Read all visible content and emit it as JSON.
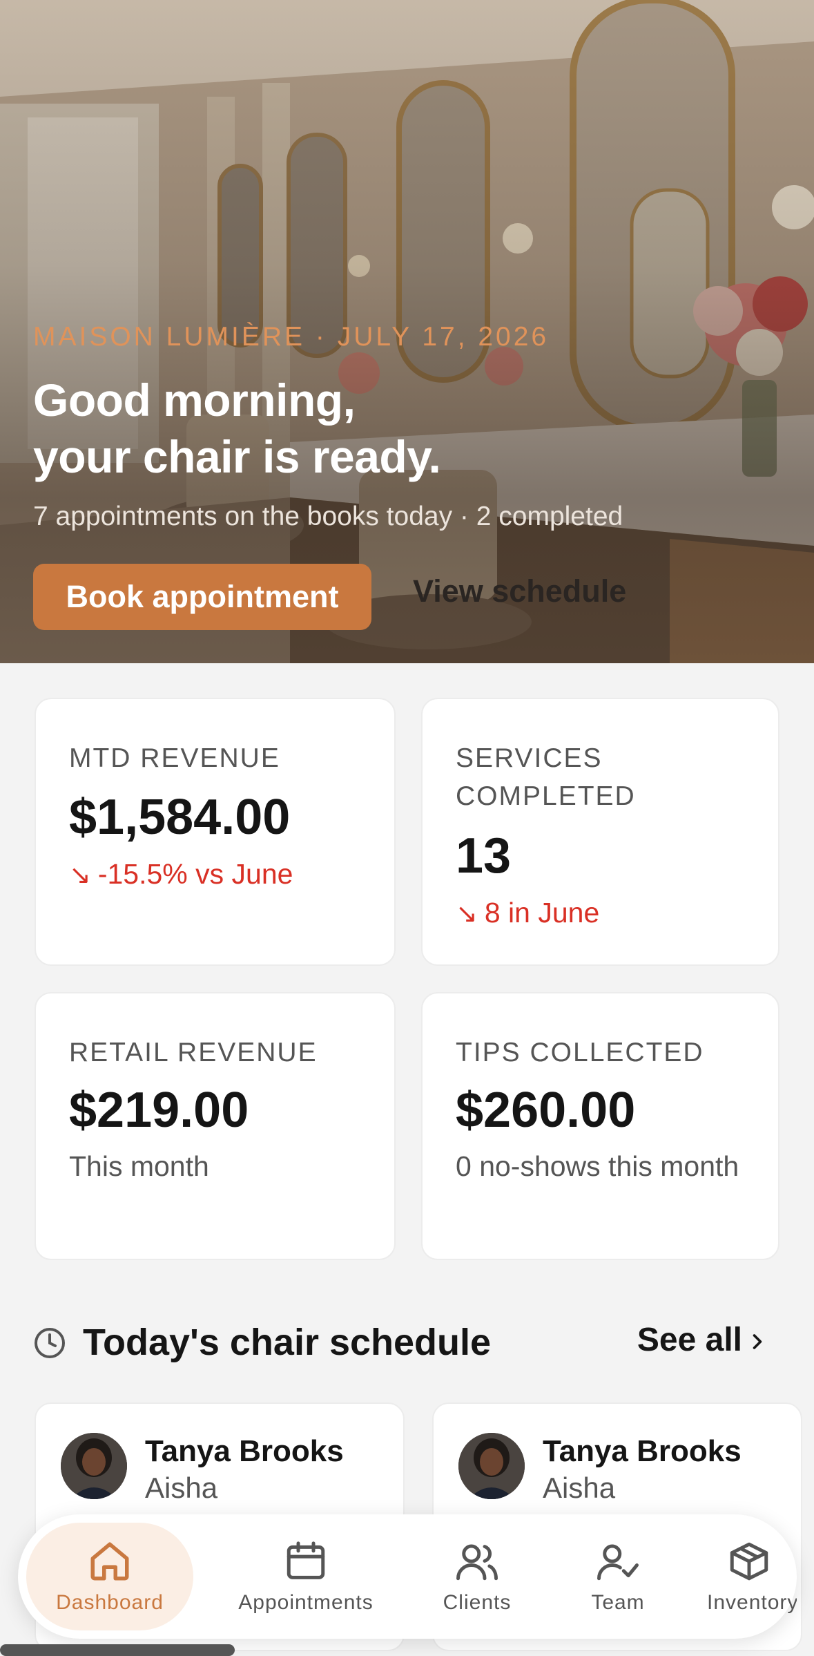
{
  "hero": {
    "eyebrow": "MAISON LUMIÈRE · JULY 17, 2026",
    "headline_line1": "Good morning,",
    "headline_line2": "your chair is ready.",
    "subline": "7 appointments on the books today · 2 completed",
    "book_label": "Book appointment",
    "view_label": "View schedule"
  },
  "stats": [
    {
      "label": "MTD REVENUE",
      "value": "$1,584.00",
      "delta": "-15.5% vs June",
      "trend": "down"
    },
    {
      "label": "SERVICES COMPLETED",
      "value": "13",
      "delta": "8 in June",
      "trend": "down"
    },
    {
      "label": "RETAIL REVENUE",
      "value": "$219.00",
      "note": "This month"
    },
    {
      "label": "TIPS COLLECTED",
      "value": "$260.00",
      "note": "0 no-shows this month"
    }
  ],
  "schedule": {
    "title": "Today's chair schedule",
    "see_all": "See all",
    "appointments": [
      {
        "client": "Tanya Brooks",
        "stylist": "Aisha"
      },
      {
        "client": "Tanya Brooks",
        "stylist": "Aisha"
      }
    ]
  },
  "nav": {
    "items": [
      {
        "label": "Dashboard",
        "icon": "home-icon",
        "active": true
      },
      {
        "label": "Appointments",
        "icon": "calendar-icon",
        "active": false
      },
      {
        "label": "Clients",
        "icon": "users-icon",
        "active": false
      },
      {
        "label": "Team",
        "icon": "user-check-icon",
        "active": false
      },
      {
        "label": "Inventory",
        "icon": "box-icon",
        "active": false
      }
    ]
  },
  "colors": {
    "accent": "#c9783f",
    "negative": "#d93025",
    "background": "#f3f3f3"
  }
}
